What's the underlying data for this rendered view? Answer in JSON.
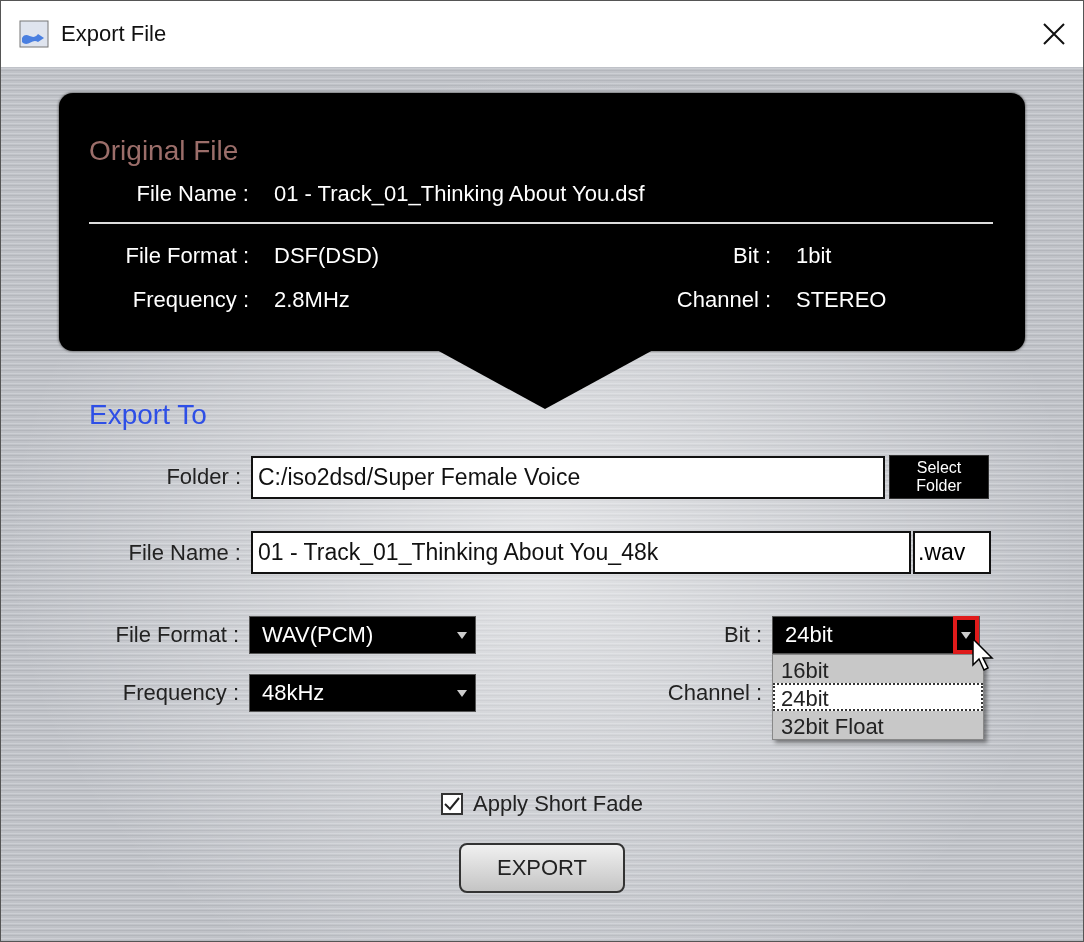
{
  "window": {
    "title": "Export File"
  },
  "original": {
    "heading": "Original File",
    "file_name": {
      "label": "File Name :",
      "value": "01 - Track_01_Thinking About You.dsf"
    },
    "fields": [
      {
        "label": "File Format :",
        "value": "DSF(DSD)"
      },
      {
        "label": "Bit :",
        "value": "1bit"
      },
      {
        "label": "Frequency :",
        "value": "2.8MHz"
      },
      {
        "label": "Channel :",
        "value": "STEREO"
      }
    ]
  },
  "export": {
    "heading": "Export To",
    "folder": {
      "label": "Folder :",
      "value": "C:/iso2dsd/Super Female Voice",
      "button": "Select Folder"
    },
    "file_name": {
      "label": "File Name :",
      "value": "01 - Track_01_Thinking About You_48k",
      "extension": ".wav"
    },
    "selects": [
      {
        "label": "File Format :",
        "value": "WAV(PCM)"
      },
      {
        "label": "Bit :",
        "value": "24bit",
        "open": true,
        "options": [
          {
            "label": "16bit",
            "selected": false
          },
          {
            "label": "24bit",
            "selected": true
          },
          {
            "label": "32bit Float",
            "selected": false
          }
        ]
      },
      {
        "label": "Frequency :",
        "value": "48kHz"
      },
      {
        "label": "Channel :"
      }
    ],
    "short_fade": {
      "label": "Apply Short Fade",
      "checked": true
    },
    "button": "EXPORT"
  }
}
